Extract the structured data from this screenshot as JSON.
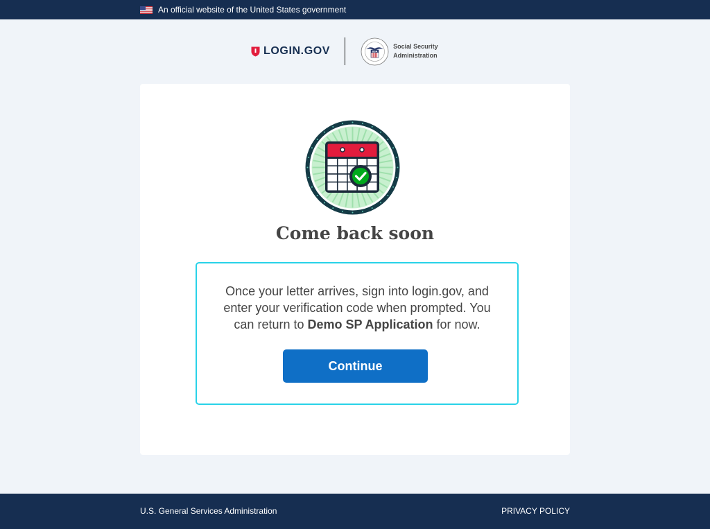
{
  "gov_banner": {
    "text": "An official website of the United States government",
    "icon": "us-flag-icon"
  },
  "header": {
    "login_logo": {
      "text": "LOGIN.GOV",
      "icon": "shield-icon"
    },
    "partner": {
      "line1": "Social Security",
      "line2": "Administration",
      "seal_text": "USA",
      "icon": "ssa-seal-icon"
    }
  },
  "main": {
    "title": "Come back soon",
    "info": {
      "text_before": "Once your letter arrives, sign into login.gov, and enter your verification code when prompted. You can return to ",
      "app_name": "Demo SP Application",
      "text_after": " for now."
    },
    "continue_label": "Continue"
  },
  "footer": {
    "left": "U.S. General Services Administration",
    "right": "PRIVACY POLICY"
  },
  "colors": {
    "navy": "#162e51",
    "primary": "#0f6fc6",
    "cyan_border": "#28d2e8",
    "page_bg": "#f0f4f9",
    "red": "#e21c3d",
    "green": "#00a91c"
  }
}
